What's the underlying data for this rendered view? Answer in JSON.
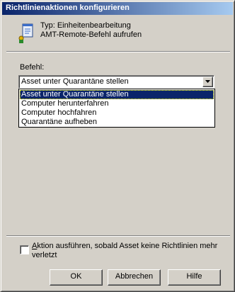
{
  "window": {
    "title": "Richtlinienaktionen konfigurieren"
  },
  "info": {
    "icon": "policy-edit-icon",
    "type_line": "Typ: Einheitenbearbeitung",
    "action_line": "AMT-Remote-Befehl aufrufen"
  },
  "command": {
    "label": "Befehl:",
    "selected": "Asset unter Quarantäne stellen",
    "options": [
      "Asset unter Quarantäne stellen",
      "Computer herunterfahren",
      "Computer hochfahren",
      "Quarantäne aufheben"
    ]
  },
  "checkbox": {
    "first_letter": "A",
    "label_rest": "ktion ausführen, sobald Asset keine Richtlinien mehr verletzt",
    "checked": false
  },
  "buttons": {
    "ok": "OK",
    "cancel": "Abbrechen",
    "help": "Hilfe"
  },
  "colors": {
    "selection": "#0a246a",
    "title_start": "#0a246a",
    "title_end": "#a6caf0",
    "face": "#d4d0c8"
  }
}
